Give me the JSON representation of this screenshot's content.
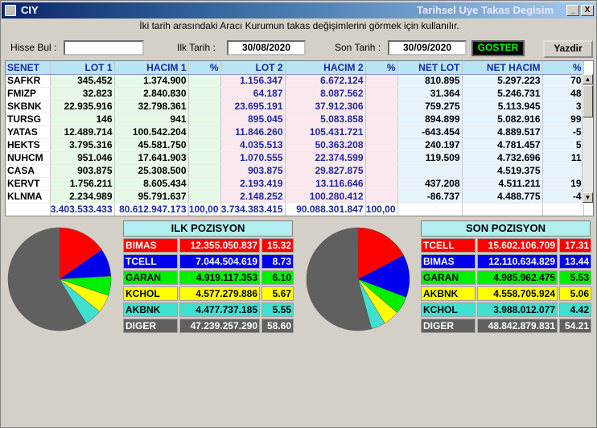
{
  "app": {
    "title": "CIY",
    "window_title": "Tarihsel Uye Takas Degisim",
    "minimize": "_",
    "maximize": "□",
    "close": "X"
  },
  "hint": "İki tarih arasındaki  Aracı Kurumun takas değişimlerini görmek için kullanılır.",
  "filters": {
    "hisse_label": "Hisse Bul :",
    "hisse_value": "",
    "ilk_label": "Ilk Tarih :",
    "ilk_value": "30/08/2020",
    "son_label": "Son Tarih :",
    "son_value": "30/09/2020",
    "goster": "GOSTER",
    "yazdir": "Yazdir"
  },
  "grid": {
    "headers": [
      "SENET",
      "LOT 1",
      "HACIM 1",
      "%",
      "LOT 2",
      "HACIM 2",
      "%",
      "NET LOT",
      "NET HACIM",
      "%"
    ],
    "rows": [
      [
        "SAFKR",
        "345.452",
        "1.374.900",
        "",
        "1.156.347",
        "6.672.124",
        "",
        "810.895",
        "5.297.223",
        "70"
      ],
      [
        "FMIZP",
        "32.823",
        "2.840.830",
        "",
        "64.187",
        "8.087.562",
        "",
        "31.364",
        "5.246.731",
        "48"
      ],
      [
        "SKBNK",
        "22.935.916",
        "32.798.361",
        "",
        "23.695.191",
        "37.912.306",
        "",
        "759.275",
        "5.113.945",
        "3"
      ],
      [
        "TURSG",
        "146",
        "941",
        "",
        "895.045",
        "5.083.858",
        "",
        "894.899",
        "5.082.916",
        "99"
      ],
      [
        "YATAS",
        "12.489.714",
        "100.542.204",
        "",
        "11.846.260",
        "105.431.721",
        "",
        "-643.454",
        "4.889.517",
        "-5"
      ],
      [
        "HEKTS",
        "3.795.316",
        "45.581.750",
        "",
        "4.035.513",
        "50.363.208",
        "",
        "240.197",
        "4.781.457",
        "5"
      ],
      [
        "NUHCM",
        "951.046",
        "17.641.903",
        "",
        "1.070.555",
        "22.374.599",
        "",
        "119.509",
        "4.732.696",
        "11"
      ],
      [
        "CASA",
        "903.875",
        "25.308.500",
        "",
        "903.875",
        "29.827.875",
        "",
        "",
        "4.519.375",
        ""
      ],
      [
        "KERVT",
        "1.756.211",
        "8.605.434",
        "",
        "2.193.419",
        "13.116.646",
        "",
        "437.208",
        "4.511.211",
        "19"
      ],
      [
        "KLNMA",
        "2.234.989",
        "95.791.637",
        "",
        "2.148.252",
        "100.280.412",
        "",
        "-86.737",
        "4.488.775",
        "-4"
      ]
    ],
    "totals": [
      "",
      "3.403.533.433",
      "80.612.947.173",
      "100,00",
      "3.734.383.415",
      "90.088.301.847",
      "100,00",
      "",
      "",
      ""
    ]
  },
  "ilk_pozisyon": {
    "title": "ILK POZISYON",
    "rows": [
      {
        "name": "BIMAS",
        "value": "12.355.050.837",
        "pct": "15.32",
        "color": "#ff0000"
      },
      {
        "name": "TCELL",
        "value": "7.044.504.619",
        "pct": "8.73",
        "color": "#0000ee"
      },
      {
        "name": "GARAN",
        "value": "4.919.117.353",
        "pct": "6.10",
        "color": "#00ee00"
      },
      {
        "name": "KCHOL",
        "value": "4.577.279.886",
        "pct": "5.67",
        "color": "#ffff00"
      },
      {
        "name": "AKBNK",
        "value": "4.477.737.185",
        "pct": "5.55",
        "color": "#40e0d0"
      },
      {
        "name": "DIGER",
        "value": "47.239.257.290",
        "pct": "58.60",
        "color": "#606060"
      }
    ]
  },
  "son_pozisyon": {
    "title": "SON POZISYON",
    "rows": [
      {
        "name": "TCELL",
        "value": "15.602.106.709",
        "pct": "17.31",
        "color": "#ff0000"
      },
      {
        "name": "BIMAS",
        "value": "12.110.634.829",
        "pct": "13.44",
        "color": "#0000ee"
      },
      {
        "name": "GARAN",
        "value": "4.985.962.475",
        "pct": "5.53",
        "color": "#00ee00"
      },
      {
        "name": "AKBNK",
        "value": "4.558.705.924",
        "pct": "5.06",
        "color": "#ffff00"
      },
      {
        "name": "KCHOL",
        "value": "3.988.012.077",
        "pct": "4.42",
        "color": "#40e0d0"
      },
      {
        "name": "DIGER",
        "value": "48.842.879.831",
        "pct": "54.21",
        "color": "#606060"
      }
    ]
  }
}
